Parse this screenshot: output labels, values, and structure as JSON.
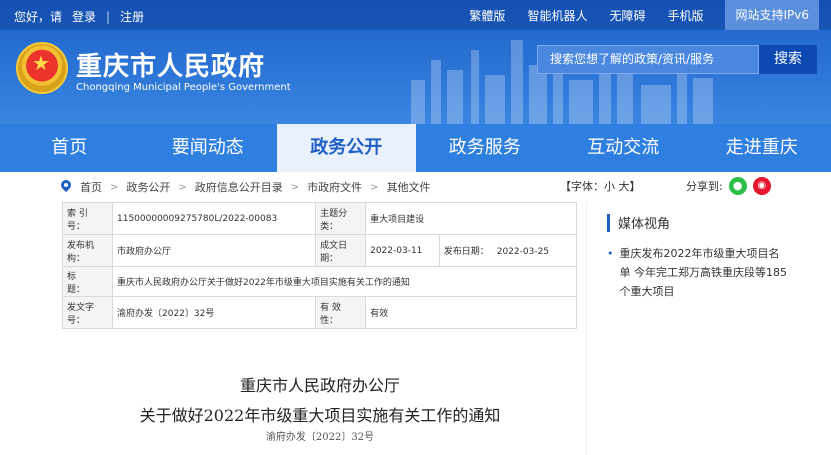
{
  "topbar": {
    "greeting": "您好，请",
    "login": "登录",
    "sep": "|",
    "register": "注册",
    "links": [
      "繁體版",
      "智能机器人",
      "无障碍",
      "手机版"
    ],
    "ipv6": "网站支持IPv6"
  },
  "header": {
    "title": "重庆市人民政府",
    "subtitle": "Chongqing Municipal People's Government",
    "search_placeholder": "搜索您想了解的政策/资讯/服务",
    "search_button": "搜索"
  },
  "nav": [
    "首页",
    "要闻动态",
    "政务公开",
    "政务服务",
    "互动交流",
    "走进重庆"
  ],
  "breadcrumb": [
    "首页",
    "政务公开",
    "政府信息公开目录",
    "市政府文件",
    "其他文件"
  ],
  "font_size": "【字体：小 大】",
  "share_label": "分享到:",
  "info": {
    "index_label": "索 引 号：",
    "index_value": "11500000009275780L/2022-00083",
    "topic_label": "主题分类：",
    "topic_value": "重大项目建设",
    "issuer_label": "发布机构：",
    "issuer_value": "市政府办公厅",
    "created_label": "成文日期：",
    "created_value": "2022-03-11",
    "published_label": "发布日期：",
    "published_value": "2022-03-25",
    "title_label": "标　　题：",
    "title_value": "重庆市人民政府办公厅关于做好2022年市级重大项目实施有关工作的通知",
    "docno_label": "发文字号：",
    "docno_value": "渝府办发〔2022〕32号",
    "valid_label": "有 效 性：",
    "valid_value": "有效"
  },
  "side": {
    "title": "媒体视角",
    "item": "重庆发布2022年市级重大项目名单 今年完工郑万高铁重庆段等185个重大项目"
  },
  "doc": {
    "line1": "重庆市人民政府办公厅",
    "line2": "关于做好2022年市级重大项目实施有关工作的通知",
    "line3": "渝府办发〔2022〕32号"
  }
}
